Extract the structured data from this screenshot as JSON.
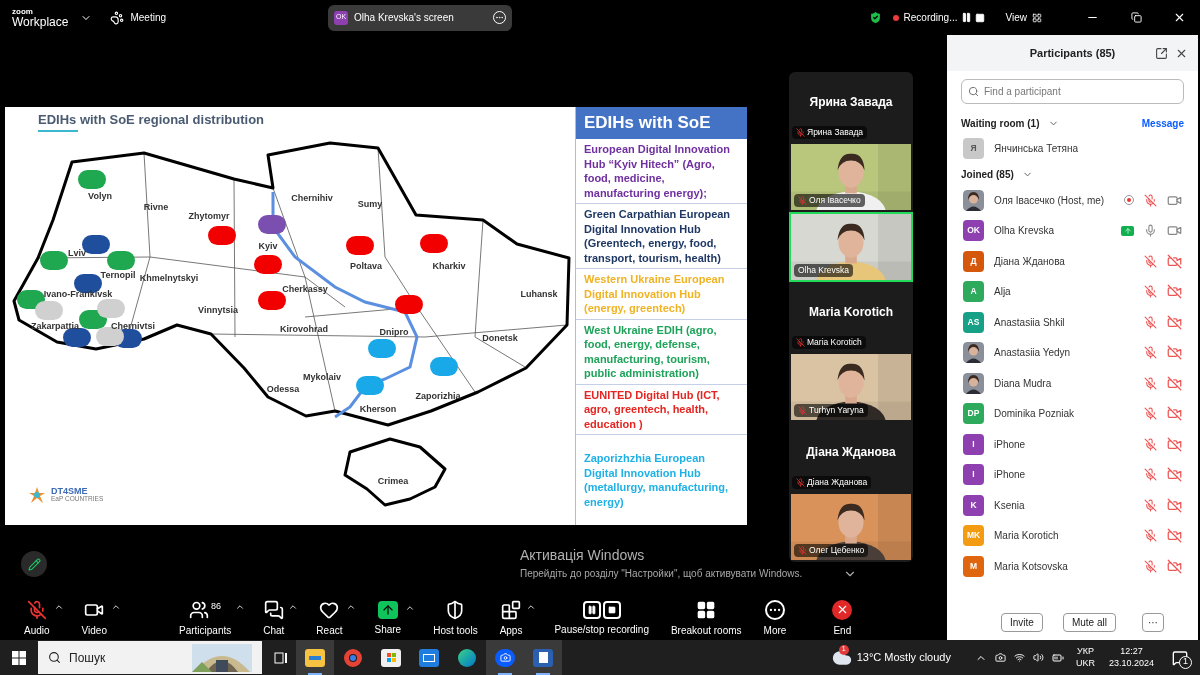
{
  "topbar": {
    "logo_top": "zoom",
    "logo_bottom": "Workplace",
    "meeting": "Meeting",
    "share_pill": {
      "initials": "OK",
      "label": "Olha Krevska's screen"
    },
    "recording": "Recording...",
    "view": "View"
  },
  "slide": {
    "title": "EDIHs with SoE regional distribution",
    "regions": [
      "Volyn",
      "Rivne",
      "Zhytomyr",
      "Chernihiv",
      "Sumy",
      "Lviv",
      "Kyiv",
      "Ternopil",
      "Khmelnytskyi",
      "Poltava",
      "Kharkiv",
      "Ivano-Frankivsk",
      "Cherkassy",
      "Vinnytsia",
      "Luhansk",
      "Zakarpattia",
      "Chernivtsi",
      "Kirovohrad",
      "Dnipro",
      "Donetsk",
      "Mykolaiv",
      "Odessa",
      "Zaporizhia",
      "Kherson",
      "Crimea"
    ],
    "markers": [
      {
        "color": "#1fa84f"
      },
      {
        "color": "#1fa84f"
      },
      {
        "color": "#1fa84f"
      },
      {
        "color": "#1fa84f"
      },
      {
        "color": "#1fa84f"
      },
      {
        "color": "#1f4e9c"
      },
      {
        "color": "#1f4e9c"
      },
      {
        "color": "#1f4e9c"
      },
      {
        "color": "#1f4e9c"
      },
      {
        "color": "#d0d0d0"
      },
      {
        "color": "#d0d0d0"
      },
      {
        "color": "#d0d0d0"
      },
      {
        "color": "#7b4fb0"
      },
      {
        "color": "#f20000"
      },
      {
        "color": "#f20000"
      },
      {
        "color": "#f20000"
      },
      {
        "color": "#f20000"
      },
      {
        "color": "#f20000"
      },
      {
        "color": "#f20000"
      },
      {
        "color": "#1aa9e8"
      },
      {
        "color": "#1aa9e8"
      },
      {
        "color": "#1aa9e8"
      }
    ],
    "logo": "DT4SME",
    "logo_sub": "EaP COUNTRIES",
    "legend_title": "EDIHs with SoE",
    "hubs": [
      {
        "text": "European Digital Innovation Hub “Kyiv Hitech” (Agro, food, medicine, manufacturing energy);",
        "color": "#7030a0"
      },
      {
        "text": "Green Carpathian European Digital Innovation Hub (Greentech, energy, food, transport, tourism, health)",
        "color": "#1f3864"
      },
      {
        "text": "Western Ukraine European Digital Innovation Hub (energy, greentech)",
        "color": "#f0b323"
      },
      {
        "text": "West Ukraine EDIH (agro, food, energy, defense, manufacturing, tourism, public administration)",
        "color": "#1fa35a"
      },
      {
        "text": "EUNITED Digital Hub (ICT, agro, greentech, health, education )",
        "color": "#e52521"
      },
      {
        "text": "Zaporizhzhia European Digital Innovation Hub (metallurgy, manufacturing, energy)",
        "color": "#1fb1e6"
      }
    ]
  },
  "video_tiles": [
    {
      "kind": "name",
      "title": "Ярина Завада",
      "label": "Ярина Завада",
      "muted": true
    },
    {
      "kind": "video",
      "label": "Оля Івасечко",
      "muted": true,
      "speaking": false
    },
    {
      "kind": "video",
      "label": "Olha Krevska",
      "muted": false,
      "speaking": true
    },
    {
      "kind": "name",
      "title": "Maria Korotich",
      "label": "Maria Korotich",
      "muted": true
    },
    {
      "kind": "video",
      "label": "Turhyn Yaryna",
      "muted": true,
      "speaking": false
    },
    {
      "kind": "name",
      "title": "Діана Жданова",
      "label": "Діана Жданова",
      "muted": true
    },
    {
      "kind": "video",
      "label": "Олег Цебенко",
      "muted": true,
      "speaking": false
    }
  ],
  "participants_panel": {
    "title": "Participants (85)",
    "search_placeholder": "Find a participant",
    "waiting_header": "Waiting room (1)",
    "message": "Message",
    "waiting": [
      {
        "name": "Янчинська Тетяна",
        "avatar": {
          "kind": "initials",
          "text": "Я",
          "color": "#c8c8c8"
        }
      }
    ],
    "joined_header": "Joined (85)",
    "joined": [
      {
        "name": "Оля Івасечко (Host, me)",
        "recording": true,
        "sharing": false,
        "muted": true,
        "video_off": false
      },
      {
        "name": "Olha Krevska",
        "avatar": {
          "kind": "initials",
          "text": "OK",
          "color": "#8e3fb0"
        },
        "recording": false,
        "sharing": true,
        "muted": false,
        "video_off": false
      },
      {
        "name": "Діана Жданова",
        "avatar": {
          "kind": "initials",
          "text": "Д",
          "color": "#d4570b"
        },
        "muted": true,
        "video_off": true
      },
      {
        "name": "Alja",
        "avatar": {
          "kind": "initials",
          "text": "A",
          "color": "#2eaa5c"
        },
        "muted": true,
        "video_off": true
      },
      {
        "name": "Anastasiia Shkil",
        "avatar": {
          "kind": "initials",
          "text": "AS",
          "color": "#16a085"
        },
        "muted": true,
        "video_off": true
      },
      {
        "name": "Anastasiia Yedyn",
        "muted": true,
        "video_off": true
      },
      {
        "name": "Diana Mudra",
        "muted": true,
        "video_off": true
      },
      {
        "name": "Dominika Pozniak",
        "avatar": {
          "kind": "initials",
          "text": "DP",
          "color": "#2eaa5c"
        },
        "muted": true,
        "video_off": true
      },
      {
        "name": "iPhone",
        "avatar": {
          "kind": "initials",
          "text": "I",
          "color": "#8e3fb0"
        },
        "muted": true,
        "video_off": true
      },
      {
        "name": "iPhone",
        "avatar": {
          "kind": "initials",
          "text": "I",
          "color": "#8e3fb0"
        },
        "muted": true,
        "video_off": true
      },
      {
        "name": "Ksenia",
        "avatar": {
          "kind": "initials",
          "text": "K",
          "color": "#8e3fb0"
        },
        "muted": true,
        "video_off": true
      },
      {
        "name": "Maria Korotich",
        "avatar": {
          "kind": "initials",
          "text": "MK",
          "color": "#f29b13"
        },
        "muted": true,
        "video_off": true
      },
      {
        "name": "Maria Kotsovska",
        "avatar": {
          "kind": "initials",
          "text": "M",
          "color": "#e0650f"
        },
        "muted": true,
        "video_off": true
      }
    ],
    "buttons": [
      "Invite",
      "Mute all",
      "···"
    ]
  },
  "toolbar": [
    {
      "kind": "audio",
      "label": "Audio",
      "muted": true,
      "caret": true
    },
    {
      "kind": "video",
      "label": "Video",
      "caret": true
    },
    {
      "kind": "participants",
      "label": "Participants",
      "count": "86",
      "caret": true
    },
    {
      "kind": "chat",
      "label": "Chat",
      "caret": true
    },
    {
      "kind": "react",
      "label": "React",
      "caret": true
    },
    {
      "kind": "share",
      "label": "Share",
      "caret": true
    },
    {
      "kind": "host",
      "label": "Host tools",
      "caret": false
    },
    {
      "kind": "apps",
      "label": "Apps",
      "caret": true
    },
    {
      "kind": "recording",
      "label": "Pause/stop recording",
      "caret": false
    },
    {
      "kind": "breakout",
      "label": "Breakout rooms",
      "caret": false
    },
    {
      "kind": "more",
      "label": "More",
      "caret": false
    },
    {
      "kind": "end",
      "label": "End",
      "caret": false
    }
  ],
  "windows_activation": {
    "title": "Активація Windows",
    "text": "Перейдіть до розділу \"Настройки\", щоб активувати Windows."
  },
  "taskbar": {
    "search": "Пошук",
    "weather_badge": "1",
    "weather": "13°C Mostly cloudy",
    "lang_top": "УКР",
    "lang_bottom": "UKR",
    "time": "12:27",
    "date": "23.10.2024",
    "notifications": "1"
  }
}
